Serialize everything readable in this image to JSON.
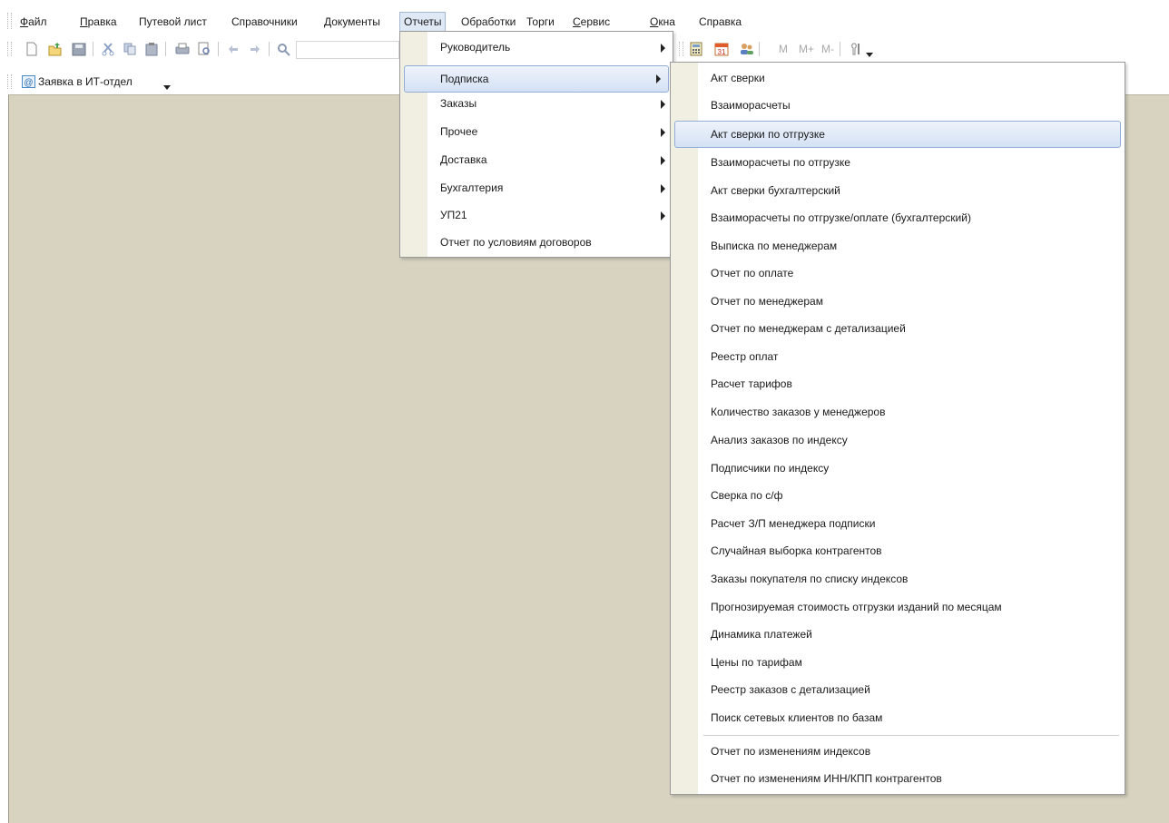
{
  "menubar": {
    "items": [
      "Файл",
      "Правка",
      "Путевой лист",
      "Справочники",
      "Документы",
      "Отчеты",
      "Обработки",
      "Торги",
      "Сервис",
      "Окна",
      "Справка"
    ]
  },
  "toolbar2": {
    "request_label": "Заявка в ИТ-отдел"
  },
  "toolbar": {
    "mem_labels": [
      "M",
      "M+",
      "M-"
    ],
    "calendar_day": "31"
  },
  "reports_menu": {
    "items": [
      "Руководитель",
      "Подписка",
      "Заказы",
      "Прочее",
      "Доставка",
      "Бухгалтерия",
      "УП21",
      "Отчет по условиям договоров"
    ]
  },
  "subscription_menu": {
    "items": [
      "Акт сверки",
      "Взаиморасчеты",
      "Акт сверки по отгрузке",
      "Взаиморасчеты по отгрузке",
      "Акт сверки бухгалтерский",
      "Взаиморасчеты по отгрузке/оплате (бухгалтерский)",
      "Выписка по менеджерам",
      "Отчет по оплате",
      "Отчет по менеджерам",
      "Отчет по менеджерам с детализацией",
      "Реестр оплат",
      "Расчет тарифов",
      "Количество заказов у менеджеров",
      "Анализ заказов по индексу",
      "Подписчики по индексу",
      "Сверка по с/ф",
      "Расчет З/П менеджера подписки",
      "Случайная выборка контрагентов",
      "Заказы покупателя по списку индексов",
      "Прогнозируемая стоимость отгрузки изданий по месяцам",
      "Динамика платежей",
      "Цены по тарифам",
      "Реестр заказов с детализацией",
      "Поиск сетевых клиентов по базам"
    ],
    "extra_items": [
      "Отчет по изменениям индексов",
      "Отчет по изменениям ИНН/КПП контрагентов"
    ]
  },
  "colors": {
    "workspace": "#d7d3c0",
    "highlight": "#d4e1f4",
    "gutter": "#f0efe2"
  }
}
